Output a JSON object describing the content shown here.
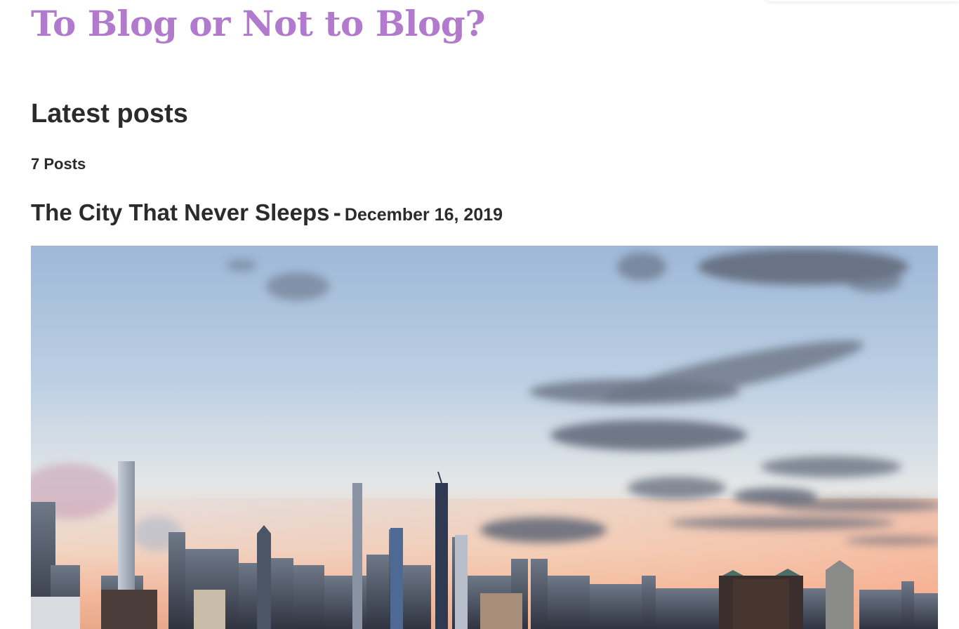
{
  "site": {
    "title": "To Blog or Not to Blog?",
    "title_color": "#b17acc"
  },
  "main": {
    "section_heading": "Latest posts",
    "post_count": "7 Posts",
    "posts": [
      {
        "title": "The City That Never Sleeps",
        "separator": "-",
        "date": "December 16, 2019",
        "image_description_icon": "city-skyline-photo"
      }
    ]
  }
}
